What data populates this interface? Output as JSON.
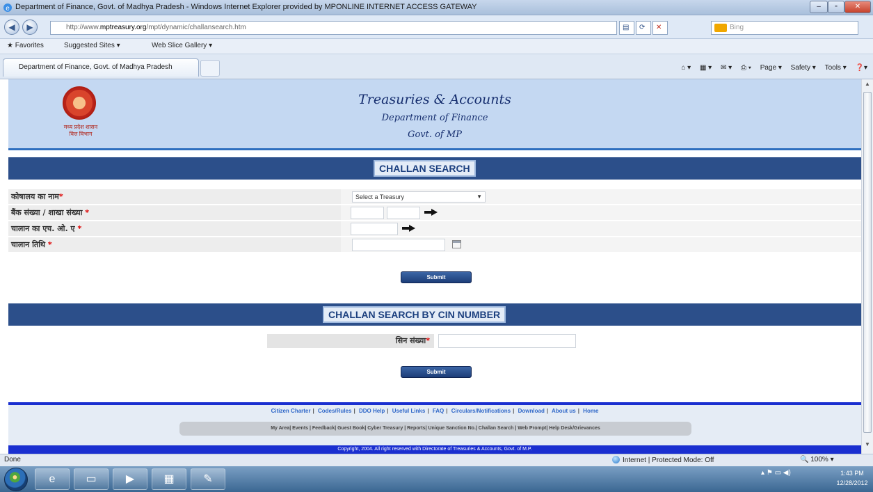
{
  "window": {
    "title": "Department of Finance, Govt. of Madhya Pradesh - Windows Internet Explorer provided by MPONLINE INTERNET ACCESS GATEWAY"
  },
  "address_bar": {
    "url_prefix": "http://www.",
    "url_domain": "mptreasury.org",
    "url_path": "/mpt/dynamic/challansearch.htm",
    "search_placeholder": "Bing"
  },
  "favorites_bar": {
    "favorites": "Favorites",
    "suggested_sites": "Suggested Sites ▾",
    "web_slice_gallery": "Web Slice Gallery ▾"
  },
  "tab": {
    "label": "Department of Finance, Govt. of Madhya Pradesh"
  },
  "command_bar": {
    "page": "Page ▾",
    "safety": "Safety ▾",
    "tools": "Tools ▾"
  },
  "header": {
    "title": "Treasuries & Accounts",
    "subtitle1": "Department of Finance",
    "subtitle2": "Govt. of MP",
    "logo_line1": "मध्य प्रदेश शासन",
    "logo_line2": "वित्त विभाग"
  },
  "challan_search": {
    "heading": "CHALLAN SEARCH",
    "fields": [
      {
        "label": "कोषालय का नाम",
        "required": "*"
      },
      {
        "label": "बैंक संख्या / शाखा संख्या",
        "required": "*"
      },
      {
        "label": "चालान का एच. ओ. ए",
        "required": "*"
      },
      {
        "label": "चालान तिथि",
        "required": "*"
      }
    ],
    "treasury_select_value": "Select a Treasury",
    "submit_label": "Submit"
  },
  "cin_search": {
    "heading": "CHALLAN SEARCH BY CIN NUMBER",
    "label": "सिन संख्या",
    "required": "*",
    "submit_label": "Submit"
  },
  "footer": {
    "links": [
      "Citizen Charter",
      "Codes/Rules",
      "DDO Help",
      "Useful Links",
      "FAQ",
      "Circulars/Notifications",
      "Download",
      "About us",
      "Home"
    ],
    "links2": "My Area| Events | Feedback| Guest Book| Cyber Treasury | Reports| Unique Sanction No.| Challan Search | Web Prompt| Help Desk/Grievances",
    "copyright": "Copyright, 2004. All right reserved with Directorate of Treasuries & Accounts, Govt. of M.P."
  },
  "status_bar": {
    "status": "Done",
    "zone": "Internet | Protected Mode: Off",
    "zoom": "100%"
  },
  "taskbar": {
    "time": "1:43 PM",
    "date": "12/28/2012"
  }
}
